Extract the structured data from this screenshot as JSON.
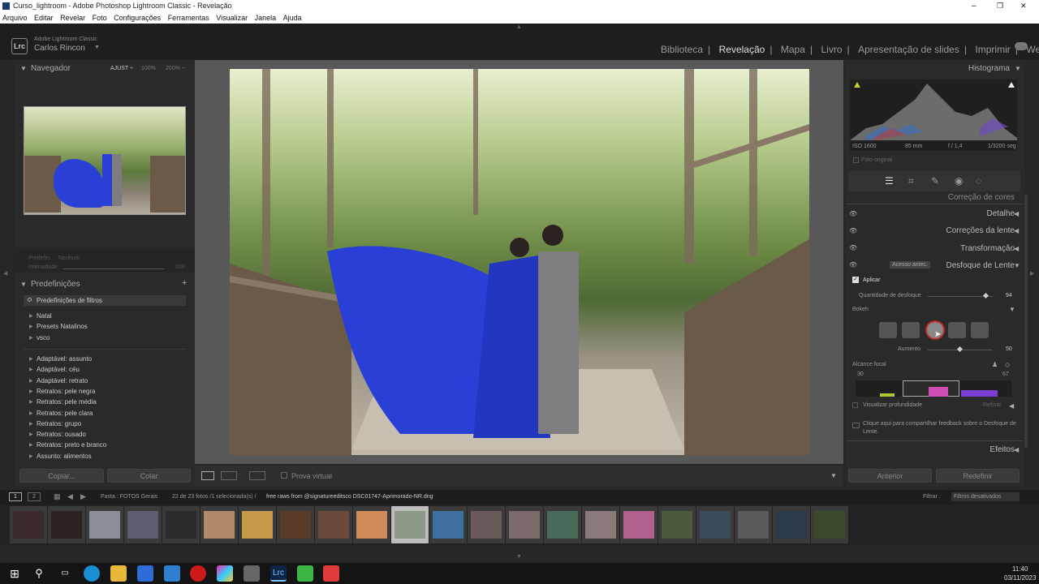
{
  "window": {
    "title": "Curso_lightroom - Adobe Photoshop Lightroom Classic - Revelação",
    "controls": [
      "–",
      "❐",
      "✕"
    ]
  },
  "menu": [
    "Arquivo",
    "Editar",
    "Revelar",
    "Foto",
    "Configurações",
    "Ferramentas",
    "Visualizar",
    "Janela",
    "Ajuda"
  ],
  "identity": {
    "logo": "Lrc",
    "product": "Adobe Lightroom Classic",
    "user": "Carlos Rincon"
  },
  "modules": [
    {
      "label": "Biblioteca",
      "active": false
    },
    {
      "label": "Revelação",
      "active": true
    },
    {
      "label": "Mapa",
      "active": false
    },
    {
      "label": "Livro",
      "active": false
    },
    {
      "label": "Apresentação de slides",
      "active": false
    },
    {
      "label": "Imprimir",
      "active": false
    },
    {
      "label": "Web",
      "active": false
    }
  ],
  "left": {
    "navigator": {
      "title": "Navegador",
      "zoom": [
        "AJUST ÷",
        "100%",
        "200% ÷"
      ]
    },
    "preset_amount": {
      "label1": "Predefin.",
      "value1": "Nenhum",
      "label2": "Intensidade",
      "value2": "100"
    },
    "presets_title": "Predefinições",
    "filter_placeholder": "Predefinições de filtros",
    "groups1": [
      "Natal",
      "Presets Natalinos",
      "vsco"
    ],
    "groups2": [
      "Adaptável: assunto",
      "Adaptável: céu",
      "Adaptável: retrato",
      "Retratos: pele negra",
      "Retratos: pele média",
      "Retratos: pele clara",
      "Retratos: grupo",
      "Retratos: ousado",
      "Retratos: preto e branco",
      "Assunto: alimentos"
    ],
    "copy_label": "Copiar...",
    "paste_label": "Colar"
  },
  "toolbar": {
    "proof_label": "Prova virtual"
  },
  "right": {
    "histogram_title": "Histograma",
    "exif": [
      "ISO 1600",
      "85 mm",
      "f / 1,4",
      "1/3200 seg"
    ],
    "original_label": "Foto original",
    "sections": {
      "color": "Correção de cores",
      "detail": "Detalhe",
      "lens": "Correções da lente",
      "transform": "Transformação",
      "blur": "Desfoque de Lente",
      "effects": "Efeitos"
    },
    "early_access": "Acesso antec.",
    "apply_label": "Aplicar",
    "blur_amount_label": "Quantidade de desfoque",
    "blur_amount_value": "94",
    "bokeh_label": "Bokeh",
    "boost_label": "Aumento",
    "boost_value": "50",
    "focal_label": "Alcance focal",
    "focal_min": "30",
    "focal_max": "67",
    "depth_label": "Visualizar profundidade",
    "refine_label": "Refinar",
    "feedback_text": "Clique aqui para compartilhar feedback sobre o Desfoque de Lente.",
    "prev_label": "Anterior",
    "reset_label": "Redefinir"
  },
  "filmstrip": {
    "folder": "Pasta : FOTOS Gerais",
    "count": "22 de 23 fotos /1 selecionada(s) /",
    "file": "free raws from @signatureeditsco DSC01747-Aprimorado-NR.dng",
    "filter_label": "Filtrar :",
    "filter_value": "Filtros desativados",
    "view1": "1",
    "view2": "2"
  },
  "taskbar": {
    "time": "11:40",
    "date": "03/11/2023"
  },
  "colors": {
    "accent_red": "#c0282d",
    "dress_blue": "#2a3fd6",
    "panel_bg": "#2a2a2a"
  }
}
